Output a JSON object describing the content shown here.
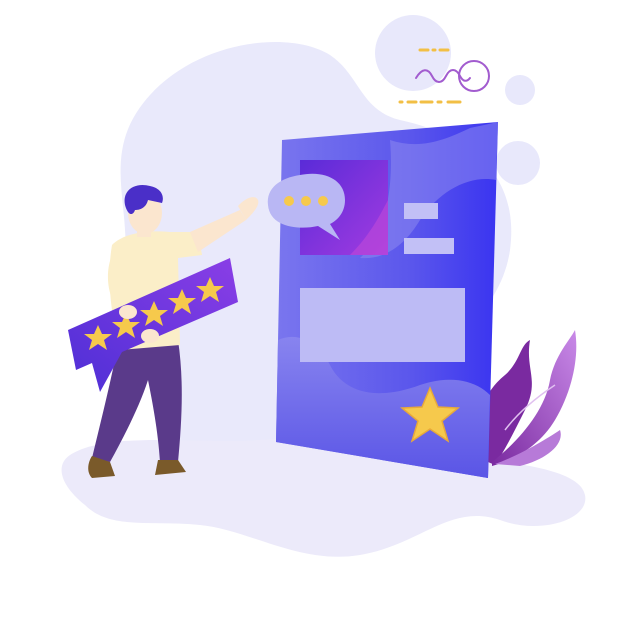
{
  "illustration": {
    "subject": "customer-review-rating",
    "rating_card": {
      "stars_filled": 5,
      "stars_total": 5
    },
    "phone_screen": {
      "featured_star": 1
    },
    "chat_bubble": {
      "typing_dots": 3
    },
    "colors": {
      "background_blob": "#e9e9fb",
      "ground_blob": "#eceafa",
      "screen_top": "#5b57ec",
      "screen_right": "#3a34f0",
      "screen_bottom": "#6c68ea",
      "panel": "#bdbbf5",
      "photo_gradient_start": "#5a2bd8",
      "photo_gradient_end": "#a23be0",
      "star": "#f6c94c",
      "star_shade": "#e8a93a",
      "rating_card_start": "#4e2fd6",
      "rating_card_end": "#8a3ee6",
      "shirt": "#fbeec8",
      "pants": "#5a3a8a",
      "hair": "#4a2fc8",
      "skin": "#fbe6cf",
      "shoes": "#7a5a2a",
      "plant": "#8a3ab0",
      "plant_light": "#c9a2e8",
      "deco_circle": "#e6e6fa",
      "deco_line": "#9b5bd0",
      "deco_dash": "#f4c24a"
    }
  }
}
